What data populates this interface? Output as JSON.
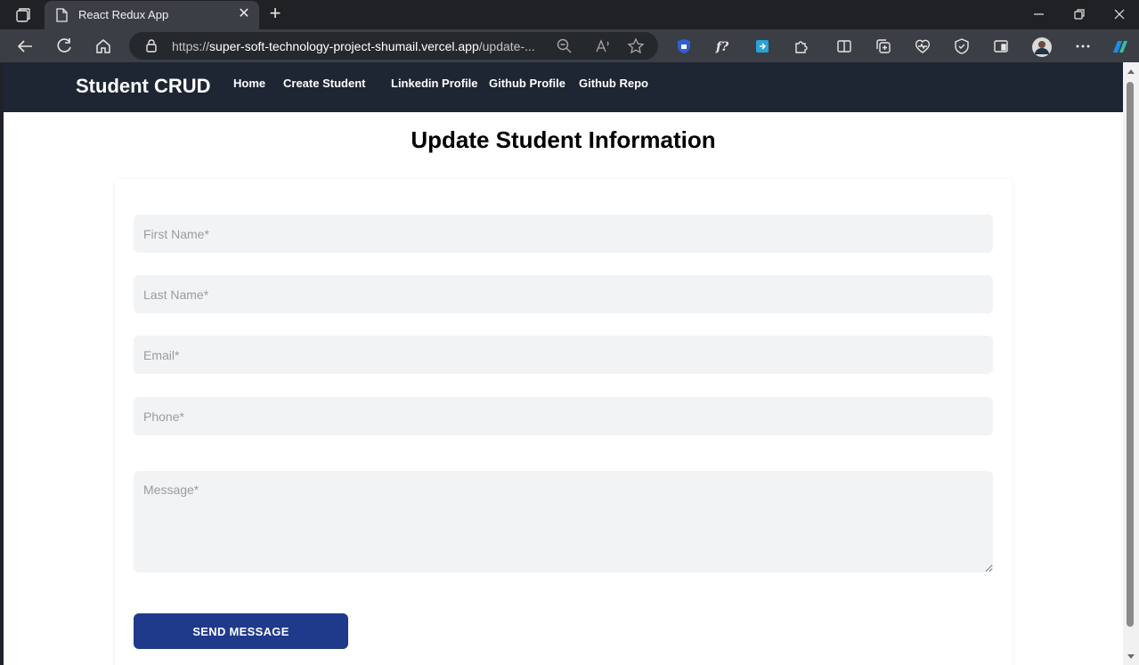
{
  "browser": {
    "tab_title": "React Redux App",
    "new_tab_symbol": "+",
    "close_symbol": "✕",
    "url_prefix": "https://",
    "url_domain": "super-soft-technology-project-shumail.vercel.app",
    "url_path": "/update-..."
  },
  "navbar": {
    "brand": "Student CRUD",
    "links": [
      "Home",
      "Create Student",
      "Linkedin Profile",
      "Github Profile",
      "Github Repo"
    ]
  },
  "page": {
    "title": "Update Student Information"
  },
  "form": {
    "first_name_placeholder": "First Name*",
    "last_name_placeholder": "Last Name*",
    "email_placeholder": "Email*",
    "phone_placeholder": "Phone*",
    "message_placeholder": "Message*",
    "submit_label": "SEND MESSAGE"
  },
  "colors": {
    "navbar_bg": "#1e2533",
    "button_bg": "#1f3a8a",
    "field_bg": "#f2f3f5"
  }
}
